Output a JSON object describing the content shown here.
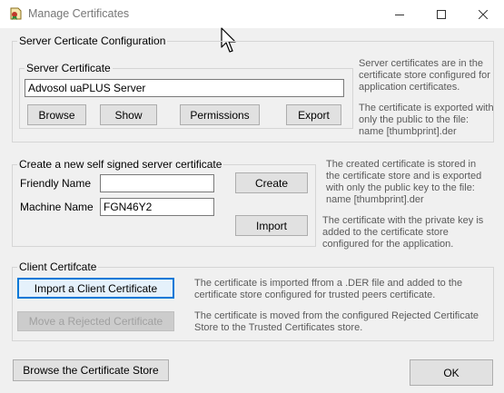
{
  "window": {
    "title": "Manage Certificates",
    "icon": "certificate-app-icon",
    "controls": [
      "minimize-icon",
      "maximize-icon",
      "close-icon"
    ]
  },
  "server_config": {
    "legend": "Server Certicate Configuration",
    "server_cert": {
      "legend": "Server Certificate",
      "value": "Advosol uaPLUS Server",
      "buttons": {
        "browse": "Browse",
        "show": "Show",
        "permissions": "Permissions",
        "export": "Export"
      }
    },
    "info1": "Server certificates are in the\ncertificate store configured for\napplication certificates.",
    "info2": "The certificate is exported with\nonly the public to the file:\nname [thumbprint].der"
  },
  "self_signed": {
    "legend": "Create a new self signed server certificate",
    "friendly_name_label": "Friendly Name",
    "friendly_name_value": "",
    "machine_name_label": "Machine Name",
    "machine_name_value": "FGN46Y2",
    "create_label": "Create",
    "import_label": "Import",
    "info_create": "The created certificate is stored in\nthe certificate store and is exported\nwith only the public key to the file:\nname [thumbprint].der",
    "info_import": "The certificate with the private key is\nadded to the certificate store\nconfigured for the application."
  },
  "client": {
    "legend": "Client Certifcate",
    "import_label": "Import a Client Certificate",
    "move_label": "Move a Rejected Certificate",
    "info_import": "The certificate is imported ffrom a .DER file and added to the\ncertificate store configured for trusted peers certificate.",
    "info_move": "The certificate is moved from the configured Rejected Certificate\nStore to the Trusted Certificates store."
  },
  "footer": {
    "browse_store_label": "Browse the Certificate Store",
    "ok_label": "OK"
  }
}
